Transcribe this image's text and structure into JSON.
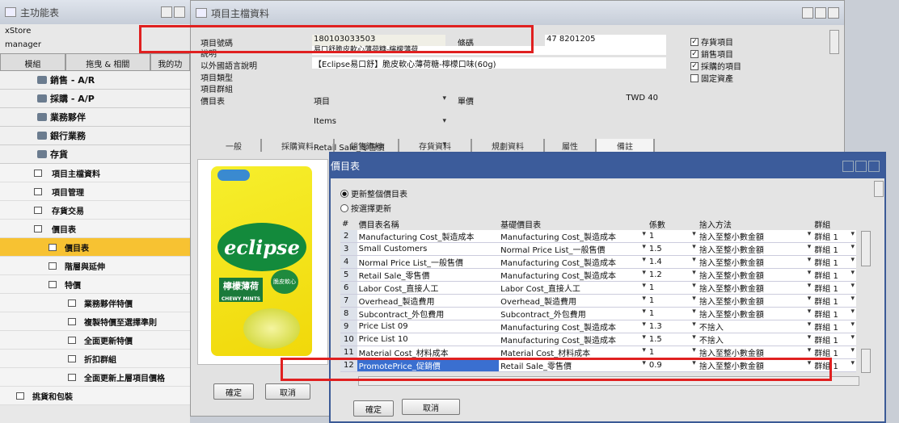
{
  "left": {
    "title": "主功能表",
    "store": "xStore",
    "user": "manager",
    "tabs": [
      "模組",
      "拖曳 & 相關",
      "我的功"
    ],
    "sections": [
      "銷售 - A/R",
      "採購 - A/P",
      "業務夥伴",
      "銀行業務",
      "存貨"
    ],
    "items": [
      "項目主檔資料",
      "項目管理",
      "存貨交易",
      "價目表",
      "價目表",
      "階層與延伸",
      "特價",
      "業務夥伴特價",
      "複製特價至選擇準則",
      "全面更新特價",
      "折扣群組",
      "全面更新上層項目價格",
      "挑貨和包裝"
    ]
  },
  "main": {
    "title": "項目主檔資料",
    "fields": {
      "item_no_label": "項目號碼",
      "item_no": "180103033503",
      "barcode_label": "條碼",
      "barcode": "47 8201205",
      "desc_label": "說明",
      "desc": "易口舒脆皮軟心薄荷糖-檸檬薄荷",
      "foreign_label": "以外國語言說明",
      "foreign": "【Eclipse易口舒】脆皮軟心薄荷糖-檸檬口味(60g)",
      "type_label": "項目類型",
      "type": "項目",
      "group_label": "項目群組",
      "group": "Items",
      "pricelist_label": "價目表",
      "pricelist": "Retail Sale_零售價",
      "unit_label": "單價",
      "unit_price": "TWD 40"
    },
    "checks": [
      {
        "label": "存貨項目",
        "on": "✓"
      },
      {
        "label": "銷售項目",
        "on": "✓"
      },
      {
        "label": "採購的項目",
        "on": "✓"
      },
      {
        "label": "固定資產",
        "on": ""
      }
    ],
    "tabs": [
      "一般",
      "採購資料",
      "銷售資料",
      "存貨資料",
      "規劃資料",
      "屬性",
      "備註"
    ],
    "ok": "確定",
    "cancel": "取消",
    "product": {
      "brand": "eclipse",
      "flavor": "檸檬薄荷",
      "sub": "CHEWY MINTS",
      "badge": "脆皮軟心"
    }
  },
  "pricelists": {
    "title": "價目表",
    "radio1": "更新整個價目表",
    "radio2": "按選擇更新",
    "cols": [
      "#",
      "價目表名稱",
      "基礎價目表",
      "係數",
      "捨入方法",
      "群組"
    ],
    "rows": [
      [
        "2",
        "Manufacturing Cost_製造成本",
        "Manufacturing Cost_製造成本",
        "1",
        "捨入至整小數金額",
        "群組 1"
      ],
      [
        "3",
        "Small Customers",
        "Normal Price List_一般售價",
        "1.5",
        "捨入至整小數金額",
        "群組 1"
      ],
      [
        "4",
        "Normal Price List_一般售價",
        "Manufacturing Cost_製造成本",
        "1.4",
        "捨入至整小數金額",
        "群組 1"
      ],
      [
        "5",
        "Retail Sale_零售價",
        "Manufacturing Cost_製造成本",
        "1.2",
        "捨入至整小數金額",
        "群組 1"
      ],
      [
        "6",
        "Labor Cost_直接人工",
        "Labor Cost_直接人工",
        "1",
        "捨入至整小數金額",
        "群組 1"
      ],
      [
        "7",
        "Overhead_製造費用",
        "Overhead_製造費用",
        "1",
        "捨入至整小數金額",
        "群組 1"
      ],
      [
        "8",
        "Subcontract_外包費用",
        "Subcontract_外包費用",
        "1",
        "捨入至整小數金額",
        "群組 1"
      ],
      [
        "9",
        "Price List 09",
        "Manufacturing Cost_製造成本",
        "1.3",
        "不捨入",
        "群組 1"
      ],
      [
        "10",
        "Price List 10",
        "Manufacturing Cost_製造成本",
        "1.5",
        "不捨入",
        "群組 1"
      ],
      [
        "11",
        "Material Cost_材料成本",
        "Material Cost_材料成本",
        "1",
        "捨入至整小數金額",
        "群組 1"
      ],
      [
        "12",
        "PromotePrice_促銷價",
        "Retail Sale_零售價",
        "0.9",
        "捨入至整小數金額",
        "群組 1"
      ]
    ],
    "ok": "確定",
    "cancel": "取消"
  }
}
